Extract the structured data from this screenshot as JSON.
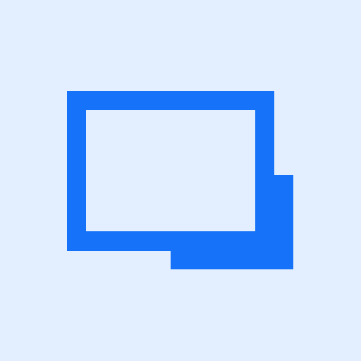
{
  "icon": {
    "name": "window-restore-icon",
    "colors": {
      "background": "#E3EFFE",
      "primary": "#1672F8",
      "inner": "#E3EFFE"
    }
  }
}
